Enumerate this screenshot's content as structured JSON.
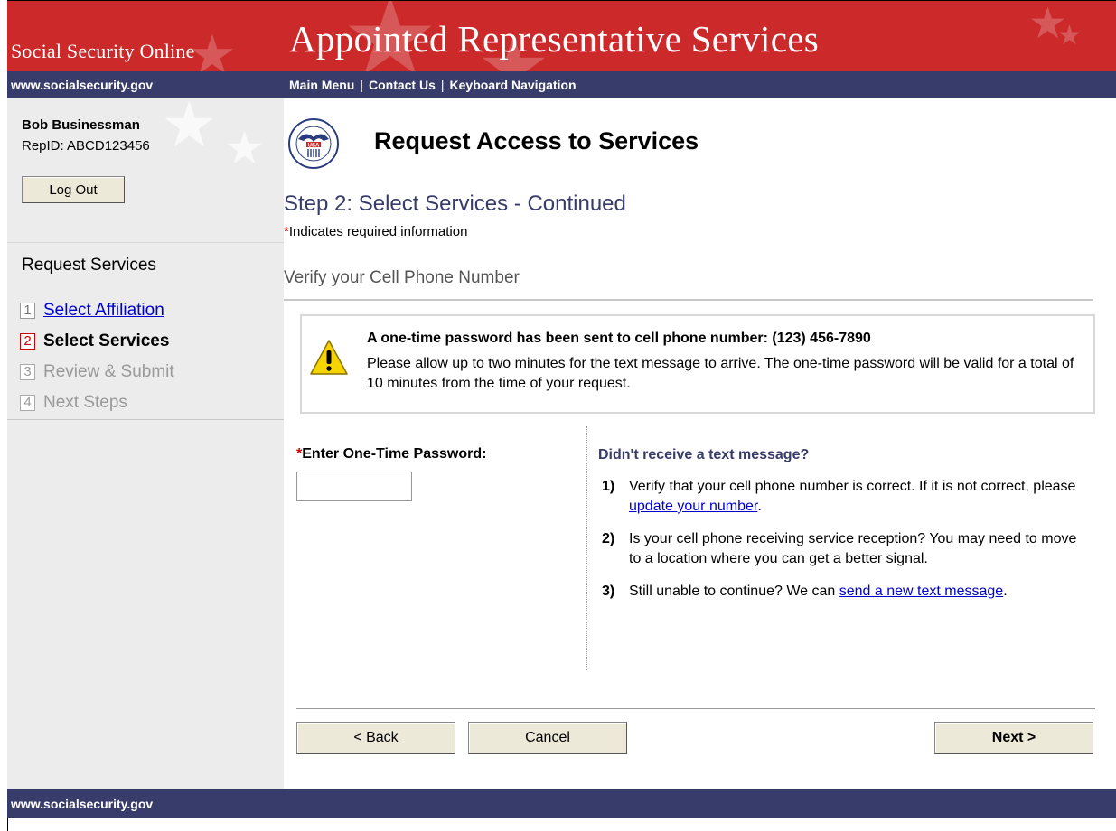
{
  "header": {
    "site_name": "Social Security Online",
    "app_title": "Appointed Representative Services",
    "site_url": "www.socialsecurity.gov",
    "nav_links": [
      "Main Menu",
      "Contact Us",
      "Keyboard Navigation"
    ],
    "separator": "|"
  },
  "sidebar": {
    "user_name": "Bob Businessman",
    "rep_id": "RepID:  ABCD123456",
    "logout_label": "Log Out",
    "section_title": "Request Services",
    "steps": [
      {
        "num": "1",
        "label": "Select Affiliation",
        "state": "done"
      },
      {
        "num": "2",
        "label": "Select Services",
        "state": "current"
      },
      {
        "num": "3",
        "label": "Review & Submit",
        "state": "future"
      },
      {
        "num": "4",
        "label": "Next Steps",
        "state": "future"
      }
    ]
  },
  "main": {
    "logo_text": "USA",
    "page_title": "Request Access to Services",
    "step_heading": "Step 2:  Select Services - Continued",
    "required_asterisk": "*",
    "required_note": "Indicates required information",
    "sub_heading": "Verify your Cell Phone Number",
    "alert": {
      "title": "A one-time password has been sent to cell phone number:  (123) 456-7890",
      "text": "Please allow up to two minutes for the text message to arrive.  The one-time password will be valid for a total of 10 minutes from the time of your request."
    },
    "otp": {
      "asterisk": "*",
      "label": "Enter One-Time Password:",
      "value": ""
    },
    "help": {
      "title": "Didn't receive a text message?",
      "item1_num": "1)",
      "item1_text": "Verify that your cell phone number is correct. If it is not correct, please ",
      "item1_link": "update your number",
      "item1_end": ".",
      "item2_num": "2)",
      "item2_text": "Is your cell phone receiving service reception?  You may need to move to a location where you can get a better signal.",
      "item3_num": "3)",
      "item3_text": "Still unable to continue? We can ",
      "item3_link": "send a new text message",
      "item3_end": "."
    },
    "buttons": {
      "back": "< Back",
      "cancel": "Cancel",
      "next": "Next >"
    }
  },
  "footer": {
    "url": "www.socialsecurity.gov"
  },
  "colors": {
    "banner_red": "#cc2a2a",
    "nav_navy": "#383c6a",
    "sidebar_gray": "#ececec",
    "link_blue": "#0000cc",
    "required_red": "#cc0000"
  }
}
